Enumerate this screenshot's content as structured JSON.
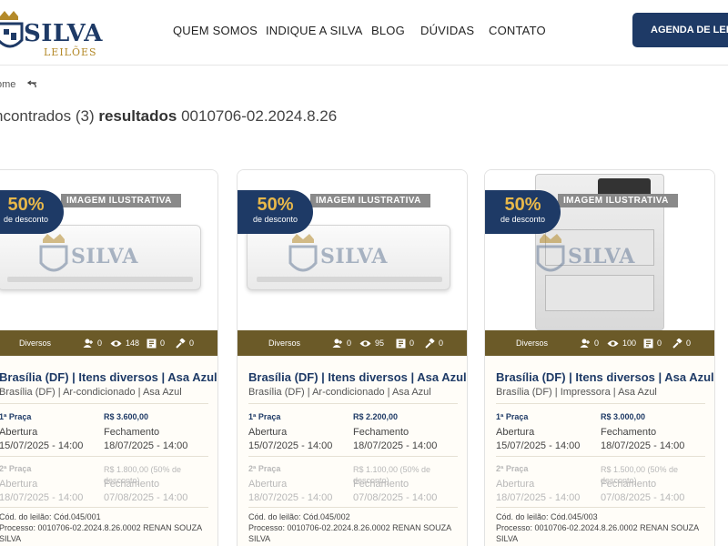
{
  "brand": {
    "name": "SILVA",
    "sub": "LEILÕES"
  },
  "nav": {
    "items": [
      "QUEM SOMOS",
      "INDIQUE A SILVA",
      "BLOG",
      "DÚVIDAS",
      "CONTATO"
    ]
  },
  "agenda_button": "AGENDA DE LEILÕES",
  "breadcrumb": {
    "home": "ome"
  },
  "results": {
    "prefix": "ncontrados (3)",
    "bold": "resultados",
    "process": "0010706-02.2024.8.26"
  },
  "cards": [
    {
      "banner": "IMAGEM ILUSTRATIVA",
      "discount_pct": "50%",
      "discount_label": "de desconto",
      "watermark": "SILVA",
      "category": "Diversos",
      "stats": {
        "bids": "0",
        "views": "148",
        "docs": "0",
        "hammer": "0"
      },
      "title": "Brasília (DF) | Itens diversos | Asa Azul",
      "subtitle": "Brasília (DF) | Ar-condicionado | Asa Azul",
      "praca1_label": "1ª Praça",
      "praca1_value": "R$ 3.600,00",
      "abertura_label": "Abertura",
      "abertura_date": "15/07/2025 - 14:00",
      "fechamento_label": "Fechamento",
      "fechamento_date": "18/07/2025 - 14:00",
      "praca2_label": "2ª Praça",
      "praca2_value": "R$ 1.800,00 (50% de desconto)",
      "abertura2_date": "18/07/2025 - 14:00",
      "fechamento2_date": "07/08/2025 - 14:00",
      "cod": "Cód. do leilão: Cód.045/001",
      "processo": "Processo: 0010706-02.2024.8.26.0002 RENAN SOUZA",
      "processo2": "SILVA"
    },
    {
      "banner": "IMAGEM ILUSTRATIVA",
      "discount_pct": "50%",
      "discount_label": "de desconto",
      "watermark": "SILVA",
      "category": "Diversos",
      "stats": {
        "bids": "0",
        "views": "95",
        "docs": "0",
        "hammer": "0"
      },
      "title": "Brasília (DF) | Itens diversos | Asa Azul",
      "subtitle": "Brasília (DF) | Ar-condicionado | Asa Azul",
      "praca1_label": "1ª Praça",
      "praca1_value": "R$ 2.200,00",
      "abertura_label": "Abertura",
      "abertura_date": "15/07/2025 - 14:00",
      "fechamento_label": "Fechamento",
      "fechamento_date": "18/07/2025 - 14:00",
      "praca2_label": "2ª Praça",
      "praca2_value": "R$ 1.100,00 (50% de desconto)",
      "abertura2_date": "18/07/2025 - 14:00",
      "fechamento2_date": "07/08/2025 - 14:00",
      "cod": "Cód. do leilão: Cód.045/002",
      "processo": "Processo: 0010706-02.2024.8.26.0002 RENAN SOUZA",
      "processo2": "SILVA"
    },
    {
      "banner": "IMAGEM ILUSTRATIVA",
      "discount_pct": "50%",
      "discount_label": "de desconto",
      "watermark": "SILVA",
      "category": "Diversos",
      "stats": {
        "bids": "0",
        "views": "100",
        "docs": "0",
        "hammer": "0"
      },
      "title": "Brasília (DF) | Itens diversos | Asa Azul",
      "subtitle": "Brasília (DF) | Impressora | Asa Azul",
      "praca1_label": "1ª Praça",
      "praca1_value": "R$ 3.000,00",
      "abertura_label": "Abertura",
      "abertura_date": "15/07/2025 - 14:00",
      "fechamento_label": "Fechamento",
      "fechamento_date": "18/07/2025 - 14:00",
      "praca2_label": "2ª Praça",
      "praca2_value": "R$ 1.500,00 (50% de desconto)",
      "abertura2_date": "18/07/2025 - 14:00",
      "fechamento2_date": "07/08/2025 - 14:00",
      "cod": "Cód. do leilão: Cód.045/003",
      "processo": "Processo: 0010706-02.2024.8.26.0002 RENAN SOUZA",
      "processo2": "SILVA"
    }
  ],
  "colors": {
    "navy": "#1e3a66",
    "gold": "#e8b84a",
    "olive": "#6b5a28"
  }
}
